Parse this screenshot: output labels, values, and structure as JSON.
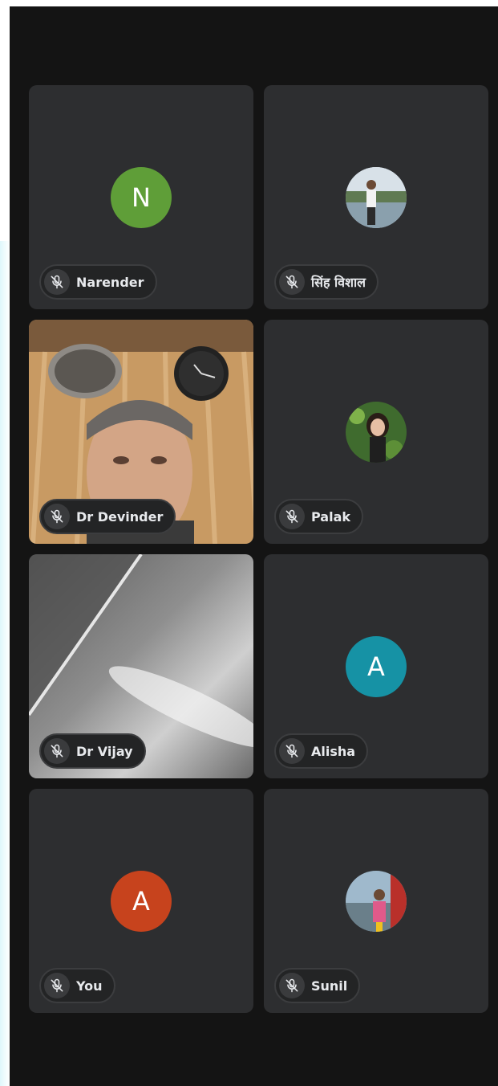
{
  "participants": [
    {
      "name": "Narender",
      "initial": "N",
      "avatar_color": "#5f9e38",
      "muted": true
    },
    {
      "name": "सिंह विशाल",
      "muted": true,
      "avatar": "photo"
    },
    {
      "name": "Dr Devinder",
      "muted": true,
      "video": "camera-feed"
    },
    {
      "name": "Palak",
      "muted": true,
      "avatar": "photo"
    },
    {
      "name": "Dr Vijay",
      "muted": true,
      "video": "camera-feed"
    },
    {
      "name": "Alisha",
      "initial": "A",
      "avatar_color": "#1692a5",
      "muted": true
    },
    {
      "name": "You",
      "initial": "A",
      "avatar_color": "#c7431d",
      "muted": true
    },
    {
      "name": "Sunil",
      "muted": true,
      "avatar": "photo"
    }
  ],
  "colors": {
    "background": "#141414",
    "tile": "#2d2e30",
    "pill": "#232425",
    "text": "#e8eaed"
  },
  "icons": {
    "mic_off": "mic-off-icon"
  }
}
